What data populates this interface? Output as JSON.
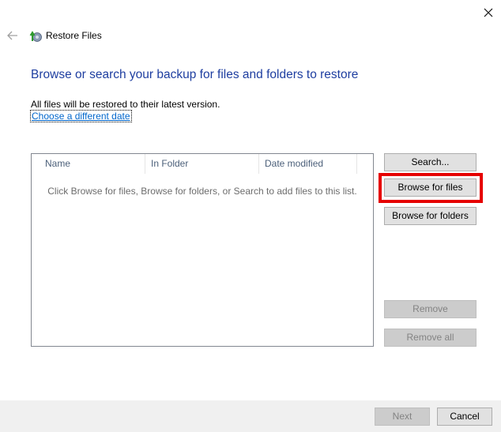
{
  "window": {
    "title": "Restore Files",
    "close_icon": "close-icon",
    "back_icon": "back-arrow-icon",
    "app_icon": "restore-files-icon"
  },
  "main": {
    "heading": "Browse or search your backup for files and folders to restore",
    "info_text": "All files will be restored to their latest version.",
    "date_link": "Choose a different date"
  },
  "file_list": {
    "columns": [
      "Name",
      "In Folder",
      "Date modified"
    ],
    "empty_message": "Click Browse for files, Browse for folders, or Search to add files to this list.",
    "rows": []
  },
  "side_buttons": {
    "search": "Search...",
    "browse_files": "Browse for files",
    "browse_folders": "Browse for folders",
    "remove": "Remove",
    "remove_all": "Remove all"
  },
  "footer": {
    "next": "Next",
    "cancel": "Cancel"
  },
  "colors": {
    "heading": "#1e3ea0",
    "link": "#0066cc",
    "highlight": "#e60000"
  }
}
